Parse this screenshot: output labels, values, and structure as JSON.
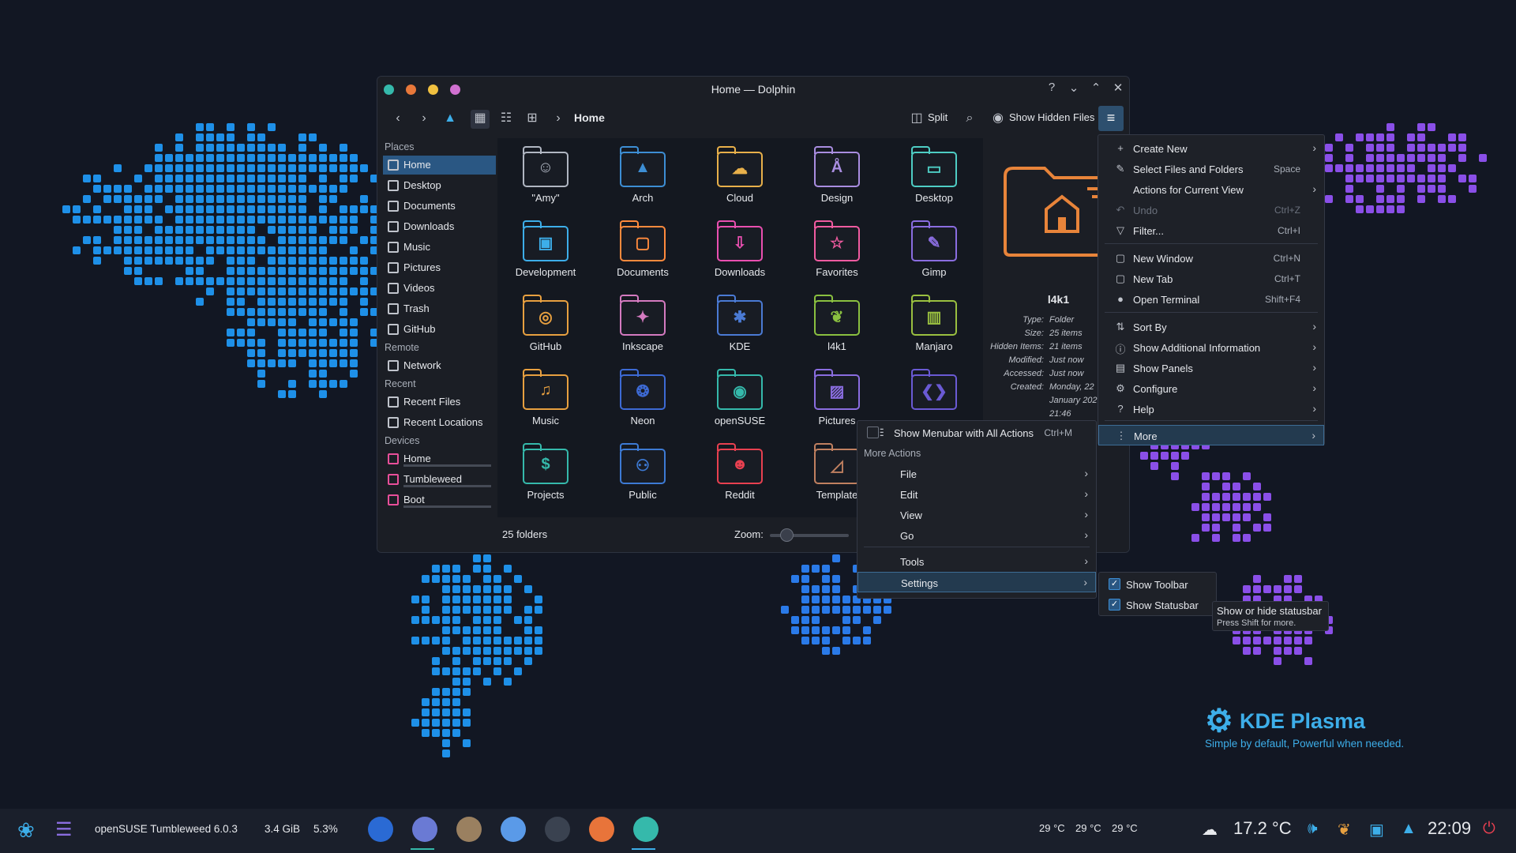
{
  "window": {
    "title": "Home — Dolphin",
    "breadcrumb": "Home",
    "split_label": "Split",
    "show_hidden_label": "Show Hidden Files"
  },
  "sidebar": {
    "places_header": "Places",
    "places": [
      "Home",
      "Desktop",
      "Documents",
      "Downloads",
      "Music",
      "Pictures",
      "Videos",
      "Trash",
      "GitHub"
    ],
    "remote_header": "Remote",
    "remote": [
      "Network"
    ],
    "recent_header": "Recent",
    "recent": [
      "Recent Files",
      "Recent Locations"
    ],
    "devices_header": "Devices",
    "devices": [
      "Home",
      "Tumbleweed",
      "Boot"
    ]
  },
  "files": [
    {
      "name": "\"Amy\"",
      "color": "#b0b6c2",
      "icon": "photo-icon"
    },
    {
      "name": "Arch",
      "color": "#3d8ed4",
      "icon": "arch-icon"
    },
    {
      "name": "Cloud",
      "color": "#e8b04a",
      "icon": "cloud-icon"
    },
    {
      "name": "Design",
      "color": "#a98de0",
      "icon": "design-icon"
    },
    {
      "name": "Desktop",
      "color": "#4ecdc4",
      "icon": "desktop-icon"
    },
    {
      "name": "Development",
      "color": "#3daee9",
      "icon": "dev-icon"
    },
    {
      "name": "Documents",
      "color": "#ff8a3d",
      "icon": "doc-icon"
    },
    {
      "name": "Downloads",
      "color": "#e94fb0",
      "icon": "download-icon"
    },
    {
      "name": "Favorites",
      "color": "#f05ba0",
      "icon": "star-icon"
    },
    {
      "name": "Gimp",
      "color": "#8a6de0",
      "icon": "gimp-icon"
    },
    {
      "name": "GitHub",
      "color": "#e8a040",
      "icon": "github-icon"
    },
    {
      "name": "Inkscape",
      "color": "#d47ac0",
      "icon": "inkscape-icon"
    },
    {
      "name": "KDE",
      "color": "#4a7ad4",
      "icon": "kde-icon"
    },
    {
      "name": "l4k1",
      "color": "#8ac040",
      "icon": "chameleon-icon"
    },
    {
      "name": "Manjaro",
      "color": "#9ac040",
      "icon": "manjaro-icon"
    },
    {
      "name": "Music",
      "color": "#e8a040",
      "icon": "music-icon"
    },
    {
      "name": "Neon",
      "color": "#3d6ad4",
      "icon": "neon-icon"
    },
    {
      "name": "openSUSE",
      "color": "#35b9ab",
      "icon": "opensuse-icon"
    },
    {
      "name": "Pictures",
      "color": "#8a6de0",
      "icon": "picture-icon"
    },
    {
      "name": "",
      "color": "#6a5ad4",
      "icon": "code-icon"
    },
    {
      "name": "Projects",
      "color": "#35b9ab",
      "icon": "dollar-icon"
    },
    {
      "name": "Public",
      "color": "#3d7ad4",
      "icon": "people-icon"
    },
    {
      "name": "Reddit",
      "color": "#e84050",
      "icon": "reddit-icon"
    },
    {
      "name": "Template",
      "color": "#c08060",
      "icon": "template-icon"
    }
  ],
  "status": {
    "count": "25 folders",
    "zoom_label": "Zoom:"
  },
  "info": {
    "name": "l4k1",
    "rows": [
      {
        "k": "Type:",
        "v": "Folder"
      },
      {
        "k": "Size:",
        "v": "25 items"
      },
      {
        "k": "Hidden Items:",
        "v": "21 items"
      },
      {
        "k": "Modified:",
        "v": "Just now"
      },
      {
        "k": "Accessed:",
        "v": "Just now"
      },
      {
        "k": "Created:",
        "v": "Monday, 22"
      },
      {
        "k": "",
        "v": "January 202"
      },
      {
        "k": "",
        "v": "21:46"
      }
    ]
  },
  "main_menu": [
    {
      "label": "Create New",
      "shortcut": "",
      "sub": true,
      "icon": "+"
    },
    {
      "label": "Select Files and Folders",
      "shortcut": "Space",
      "sub": false,
      "icon": "✎"
    },
    {
      "label": "Actions for Current View",
      "shortcut": "",
      "sub": true,
      "icon": ""
    },
    {
      "label": "Undo",
      "shortcut": "Ctrl+Z",
      "sub": false,
      "icon": "↶"
    },
    {
      "label": "Filter...",
      "shortcut": "Ctrl+I",
      "sub": false,
      "icon": "▽"
    },
    {
      "label": "New Window",
      "shortcut": "Ctrl+N",
      "sub": false,
      "icon": "▢"
    },
    {
      "label": "New Tab",
      "shortcut": "Ctrl+T",
      "sub": false,
      "icon": "▢"
    },
    {
      "label": "Open Terminal",
      "shortcut": "Shift+F4",
      "sub": false,
      "icon": "●"
    },
    {
      "label": "Sort By",
      "shortcut": "",
      "sub": true,
      "icon": "⇅"
    },
    {
      "label": "Show Additional Information",
      "shortcut": "",
      "sub": true,
      "icon": "ⓘ"
    },
    {
      "label": "Show Panels",
      "shortcut": "",
      "sub": true,
      "icon": "▤"
    },
    {
      "label": "Configure",
      "shortcut": "",
      "sub": true,
      "icon": "⚙"
    },
    {
      "label": "Help",
      "shortcut": "",
      "sub": true,
      "icon": "?"
    },
    {
      "label": "More",
      "shortcut": "",
      "sub": true,
      "icon": "⋮"
    }
  ],
  "more_menu": {
    "show_menubar": "Show Menubar with All Actions",
    "show_menubar_sc": "Ctrl+M",
    "header": "More Actions",
    "items": [
      "File",
      "Edit",
      "View",
      "Go",
      "Tools",
      "Settings"
    ]
  },
  "settings_menu": {
    "items": [
      "Show Toolbar",
      "Show Statusbar"
    ]
  },
  "tooltip": {
    "line1": "Show or hide statusbar",
    "line2": "Press Shift for more."
  },
  "brand": {
    "title": "KDE Plasma",
    "subtitle": "Simple by default, Powerful when  needed."
  },
  "taskbar": {
    "distro": "openSUSE Tumbleweed 6.0.3",
    "mem": "3.4 GiB",
    "cpu": "5.3%",
    "temps": [
      "29 °C",
      "29 °C",
      "29 °C"
    ],
    "weather": "17.2 °C",
    "clock": "22:09"
  },
  "colors": {
    "accent": "#3daee9",
    "selection": "#2a5783",
    "map_blue": "#1e90e8",
    "map_purple": "#8a4fe8"
  }
}
